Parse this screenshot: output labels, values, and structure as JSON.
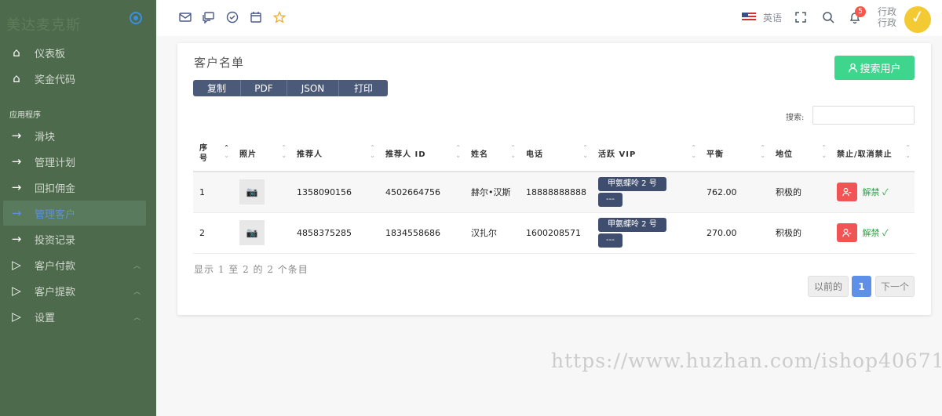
{
  "sidebar": {
    "brand": "美达麦克斯",
    "section_label": "应用程序",
    "items": [
      {
        "label": "仪表板",
        "icon": "home-icon"
      },
      {
        "label": "奖金代码",
        "icon": "home-icon"
      },
      {
        "label": "滑块",
        "icon": "arrow-right-icon"
      },
      {
        "label": "管理计划",
        "icon": "arrow-right-icon"
      },
      {
        "label": "回扣佣金",
        "icon": "arrow-right-icon"
      },
      {
        "label": "管理客户",
        "icon": "arrow-right-icon",
        "active": true
      },
      {
        "label": "投资记录",
        "icon": "arrow-right-icon"
      },
      {
        "label": "客户付款",
        "icon": "play-icon",
        "expandable": true
      },
      {
        "label": "客户提款",
        "icon": "play-icon",
        "expandable": true
      },
      {
        "label": "设置",
        "icon": "play-icon",
        "expandable": true
      }
    ]
  },
  "topbar": {
    "icons": [
      "mail-icon",
      "chat-icon",
      "check-circle-icon",
      "calendar-icon",
      "star-icon"
    ],
    "language": "英语",
    "notification_count": "5",
    "user_line1": "行政",
    "user_line2": "行政"
  },
  "main": {
    "title": "客户名单",
    "search_user_button": "搜索用户",
    "export_buttons": [
      "复制",
      "PDF",
      "JSON",
      "打印"
    ],
    "search_label": "搜索:",
    "search_value": "",
    "table": {
      "headers": [
        "序号",
        "照片",
        "推荐人",
        "推荐人 ID",
        "姓名",
        "电话",
        "活跃 VIP",
        "平衡",
        "地位",
        "禁止/取消禁止"
      ],
      "rows": [
        {
          "no": "1",
          "referrer": "1358090156",
          "referrer_id": "4502664756",
          "name": "赫尔•汉斯",
          "phone": "18888888888",
          "vip": "甲氨蝶呤 2 号",
          "vip_sub": "---",
          "balance": "762.00",
          "status": "积极的",
          "unban": "解禁"
        },
        {
          "no": "2",
          "referrer": "4858375285",
          "referrer_id": "1834558686",
          "name": "汉扎尔",
          "phone": "1600208571",
          "vip": "甲氨蝶呤 2 号",
          "vip_sub": "---",
          "balance": "270.00",
          "status": "积极的",
          "unban": "解禁"
        }
      ]
    },
    "info": "显示 1 至 2 的 2 个条目",
    "pager": {
      "prev": "以前的",
      "current": "1",
      "next": "下一个"
    }
  },
  "watermark": "https://www.huzhan.com/ishop40671",
  "colors": {
    "sidebar_bg": "#4e6a4d",
    "accent_green": "#3ed58d",
    "ban_red": "#f05454",
    "page_blue": "#5e90e8"
  }
}
